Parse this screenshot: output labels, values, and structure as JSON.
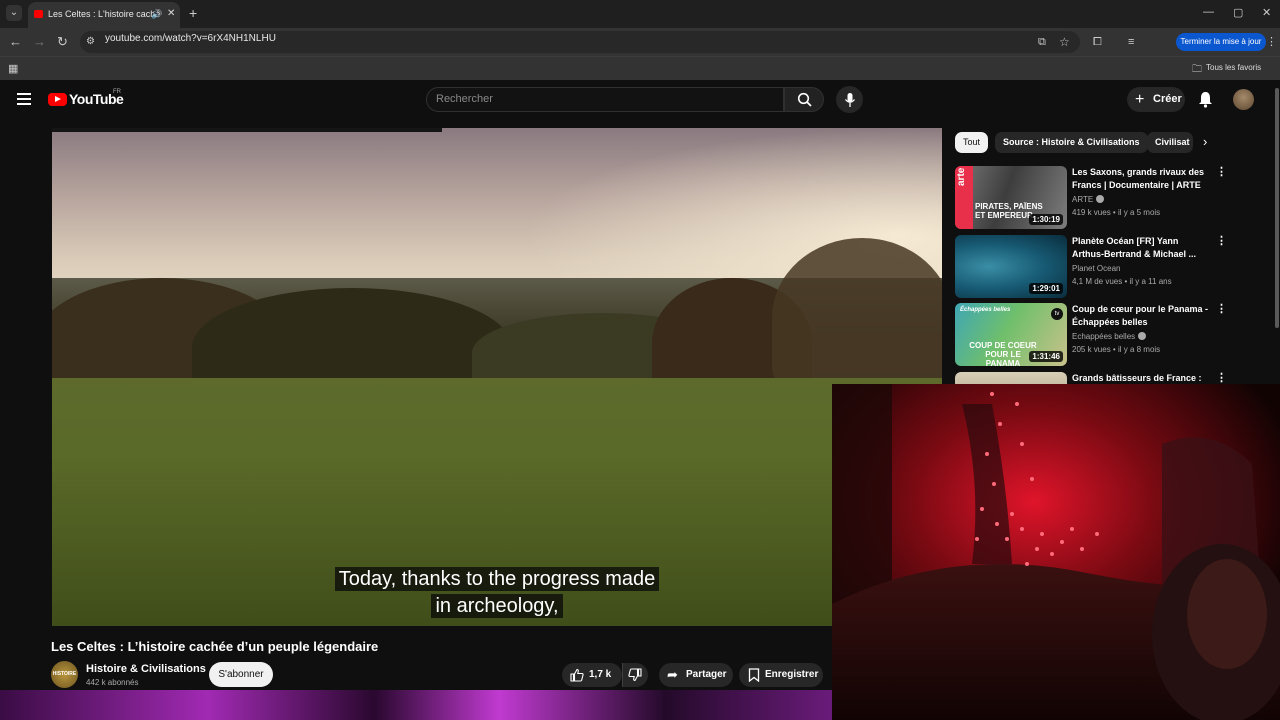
{
  "browser": {
    "tab_title": "Les Celtes : L'histoire cachée d'un peuple légendaire",
    "tab_title_short": "Les Celtes : L'histoire caché",
    "url": "youtube.com/watch?v=6rX4NH1NLHU",
    "update_button": "Terminer la mise à jour",
    "bookmarks_all": "Tous les favoris"
  },
  "youtube": {
    "logo_text": "YouTube",
    "logo_region": "FR",
    "search_placeholder": "Rechercher",
    "create_label": "Créer"
  },
  "video": {
    "caption_line1": "Today, thanks to the progress made",
    "caption_line2": "in archeology,",
    "title": "Les Celtes : L’histoire cachée d’un peuple légendaire",
    "channel_name": "Histoire & Civilisations",
    "channel_avatar_text": "HISTOIRE",
    "subscribers": "442 k abonnés",
    "subscribe_label": "S'abonner",
    "likes": "1,7 k",
    "share_label": "Partager",
    "save_label": "Enregistrer"
  },
  "sidebar": {
    "chips": [
      "Tout",
      "Source : Histoire & Civilisations",
      "Civilisat"
    ],
    "recommendations": [
      {
        "title": "Les Saxons, grands rivaux des Francs | Documentaire | ARTE",
        "channel": "ARTE",
        "verified": true,
        "meta": "419 k vues • il y a 5 mois",
        "duration": "1:30:19",
        "thumb_logo": "arte",
        "thumb_text": "PIRATES, PAÏENS ET EMPEREUR"
      },
      {
        "title": "Planète Océan [FR] Yann Arthus-Bertrand & Michael ...",
        "channel": "Planet Ocean",
        "verified": false,
        "meta": "4,1 M de vues • il y a 11 ans",
        "duration": "1:29:01"
      },
      {
        "title": "Coup de cœur pour le Panama - Échappées belles",
        "channel": "Echappées belles",
        "verified": true,
        "meta": "205 k vues • il y a 8 mois",
        "duration": "1:31:46",
        "thumb_logo": "Échappées belles",
        "thumb_text": "COUP DE COEUR POUR LE PANAMA",
        "thumb_badge": "tv"
      },
      {
        "title": "Grands bâtisseurs de France :",
        "channel": "",
        "verified": false,
        "meta": "",
        "duration": ""
      }
    ]
  },
  "colors": {
    "youtube_red": "#ff0000",
    "background": "#0f0f0f",
    "chip_bg": "#272727",
    "update_blue": "#0b57d0",
    "webcam_red": "#e0142a"
  }
}
